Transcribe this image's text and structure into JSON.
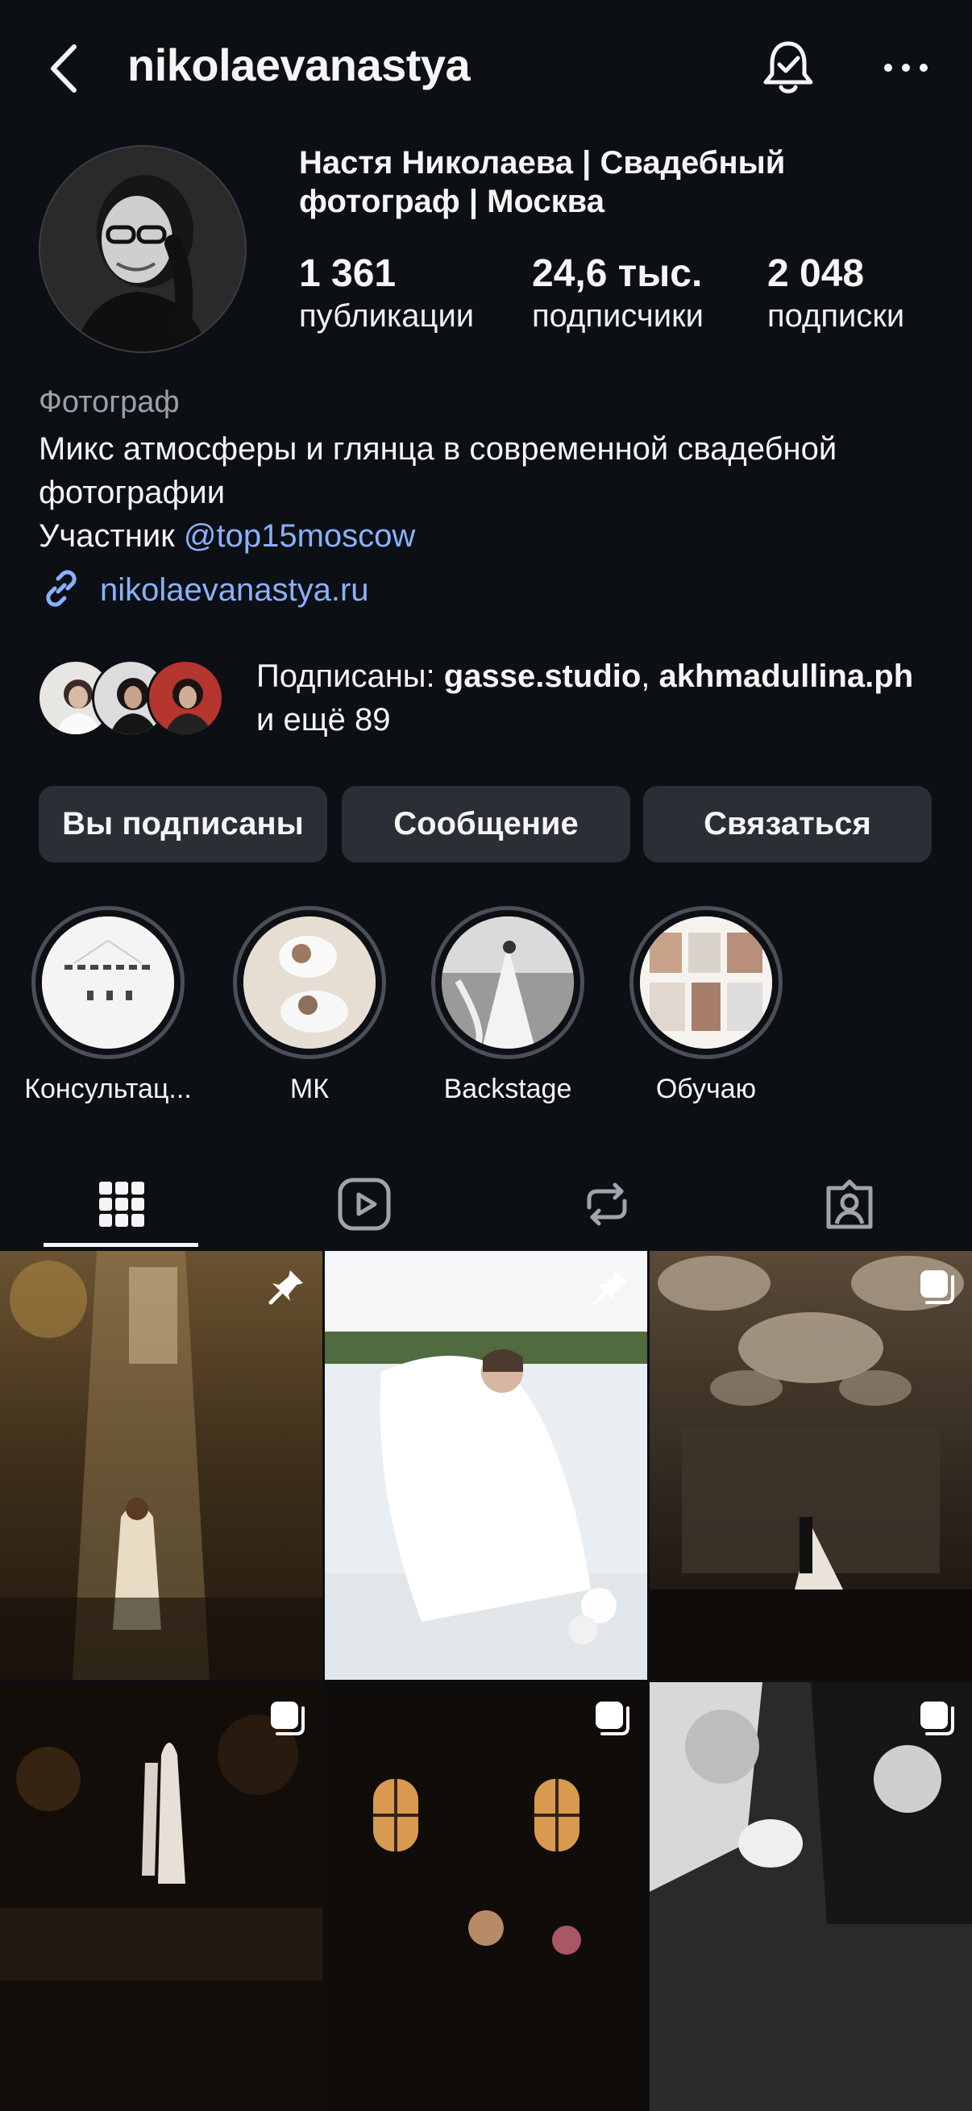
{
  "header": {
    "username": "nikolaevanastya"
  },
  "profile": {
    "full_name": "Настя Николаева | Свадебный фотограф | Москва",
    "stats": [
      {
        "value": "1 361",
        "label": "публикации"
      },
      {
        "value": "24,6 тыс.",
        "label": "подписчики"
      },
      {
        "value": "2 048",
        "label": "подписки"
      }
    ],
    "category": "Фотограф",
    "bio_line1": "Микс атмосферы и глянца в современной свадебной фотографии",
    "bio_line2_prefix": "Участник ",
    "bio_mention": "@top15moscow",
    "website": "nikolaevanastya.ru"
  },
  "followed_by": {
    "prefix": "Подписаны: ",
    "user1": "gasse.studio",
    "sep": ", ",
    "user2": "akhmadullina.ph",
    "suffix": " и ещё 89"
  },
  "actions": {
    "following": "Вы подписаны",
    "message": "Сообщение",
    "contact": "Связаться"
  },
  "highlights": [
    {
      "label": "Консультац..."
    },
    {
      "label": "МК"
    },
    {
      "label": "Backstage"
    },
    {
      "label": "Обучаю"
    }
  ],
  "tabs": [
    "grid-icon",
    "reels-icon",
    "reposts-icon",
    "tagged-icon"
  ],
  "colors": {
    "background": "#0c0f14",
    "button": "#2a2e35",
    "link": "#8ab1ff"
  }
}
